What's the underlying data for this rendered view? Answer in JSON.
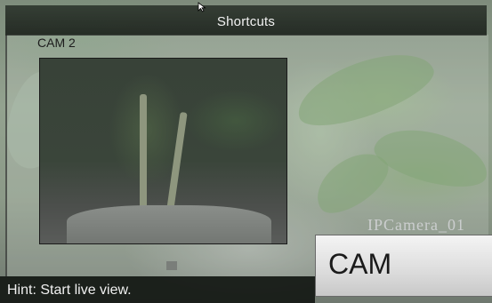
{
  "top_bar": {
    "title": "Shortcuts"
  },
  "camera": {
    "label": "CAM 2",
    "watermark": "IPCamera_01"
  },
  "cam_button": {
    "label": "CAM"
  },
  "hint": {
    "text": "Hint: Start live view."
  },
  "colors": {
    "top_bar_bg": "#262c26",
    "hint_bar_bg": "#14181a",
    "button_bg": "#e6e6e6"
  }
}
